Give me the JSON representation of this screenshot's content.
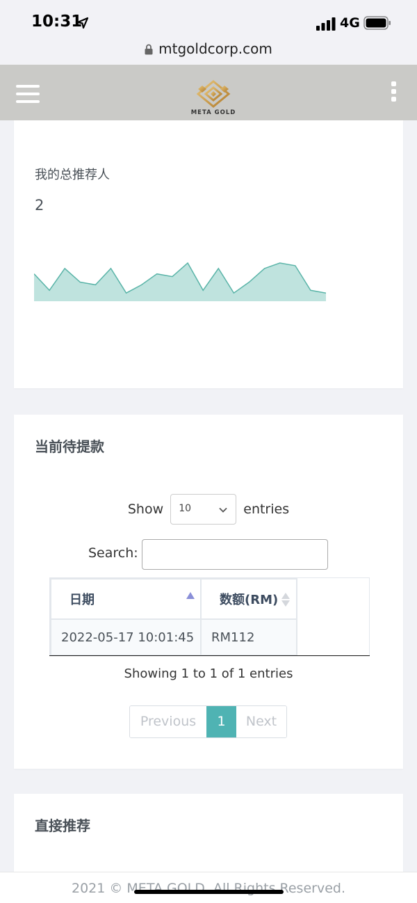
{
  "status_bar": {
    "time": "10:31",
    "network": "4G"
  },
  "browser": {
    "url": "mtgoldcorp.com"
  },
  "header": {
    "brand": "META GOLD"
  },
  "referral_card": {
    "label": "我的总推荐人",
    "value": "2",
    "sparkline_values": [
      5,
      2,
      6,
      3.5,
      3,
      6,
      1.5,
      3,
      5,
      4.5,
      7,
      2,
      6,
      1.5,
      3.5,
      6,
      7,
      6.5,
      2,
      1.5
    ],
    "sparkline_color": "#5ab4a8",
    "sparkline_fill": "#bfe3de"
  },
  "pending_card": {
    "title": "当前待提款",
    "show_label": "Show",
    "entries_label": "entries",
    "page_size": "10",
    "search_label": "Search:",
    "search_value": "",
    "columns": [
      "日期",
      "数额(RM)"
    ],
    "rows": [
      [
        "2022-05-17 10:01:45",
        "RM112"
      ]
    ],
    "info": "Showing 1 to 1 of 1 entries",
    "pagination": {
      "previous": "Previous",
      "current": "1",
      "next": "Next"
    },
    "accent_color": "#4fb3b3"
  },
  "direct_card": {
    "title": "直接推荐"
  },
  "footer": {
    "text": "2021 © META GOLD. All Rights Reserved."
  }
}
